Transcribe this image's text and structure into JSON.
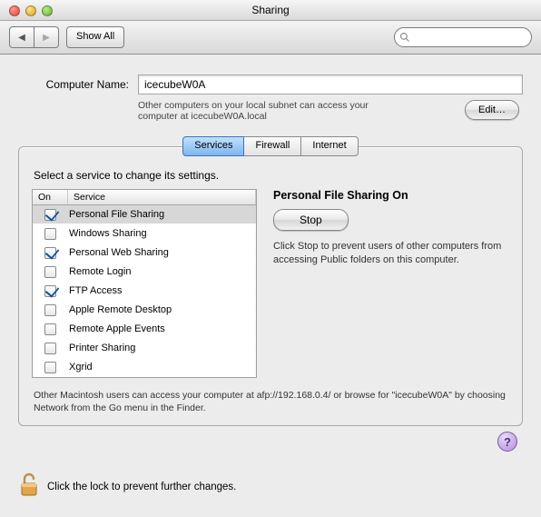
{
  "window": {
    "title": "Sharing"
  },
  "toolbar": {
    "show_all": "Show All",
    "search_placeholder": ""
  },
  "computer_name": {
    "label": "Computer Name:",
    "value": "icecubeW0A",
    "hint": "Other computers on your local subnet can access your computer at icecubeW0A.local",
    "edit": "Edit…"
  },
  "tabs": {
    "services": "Services",
    "firewall": "Firewall",
    "internet": "Internet",
    "selected": "services"
  },
  "panel": {
    "instruction": "Select a service to change its settings.",
    "columns": {
      "on": "On",
      "service": "Service"
    },
    "services": [
      {
        "on": true,
        "name": "Personal File Sharing",
        "selected": true
      },
      {
        "on": false,
        "name": "Windows Sharing"
      },
      {
        "on": true,
        "name": "Personal Web Sharing"
      },
      {
        "on": false,
        "name": "Remote Login"
      },
      {
        "on": true,
        "name": "FTP Access"
      },
      {
        "on": false,
        "name": "Apple Remote Desktop"
      },
      {
        "on": false,
        "name": "Remote Apple Events"
      },
      {
        "on": false,
        "name": "Printer Sharing"
      },
      {
        "on": false,
        "name": "Xgrid"
      }
    ],
    "detail": {
      "title": "Personal File Sharing On",
      "button": "Stop",
      "text": "Click Stop to prevent users of other computers from accessing Public folders on this computer."
    },
    "footnote": "Other Macintosh users can access your computer at afp://192.168.0.4/ or browse for \"icecubeW0A\" by choosing Network from the Go menu in the Finder."
  },
  "lock_hint": "Click the lock to prevent further changes.",
  "help_label": "?"
}
